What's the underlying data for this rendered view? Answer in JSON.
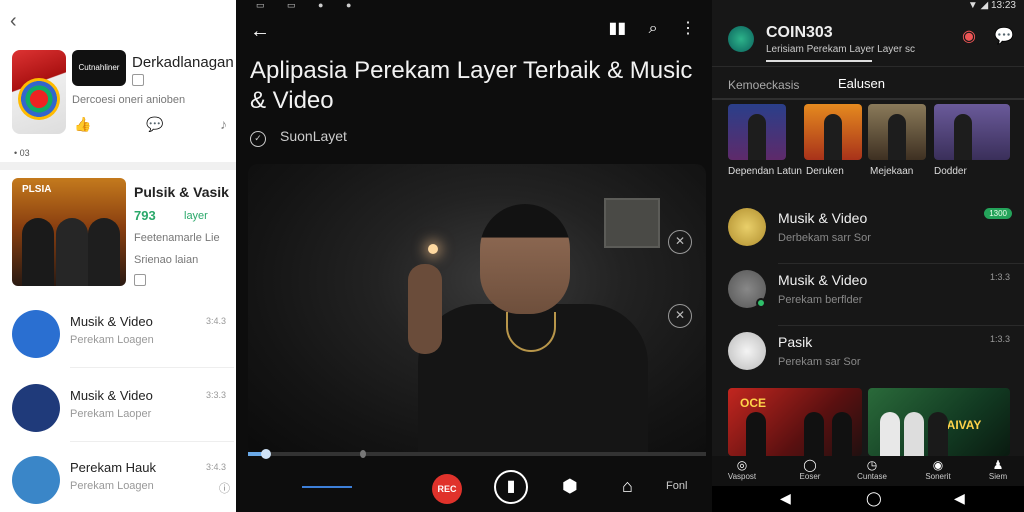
{
  "left": {
    "back_glyph": "‹",
    "app_name": "Derkadlanagan",
    "app_icon_label": "Cutnahliner",
    "app_subtitle": "Dercoesi oneri anioben",
    "meta": "• 03",
    "featured": {
      "title": "Pulsik & Vasik",
      "thumb_text": "PLSIA",
      "badge_value": "793",
      "badge_label": "layer",
      "desc": "Feetenamarle Lie",
      "desc2": "Srienao laian"
    },
    "items": [
      {
        "title": "Musik & Video",
        "subtitle": "Perekam Loagen",
        "count": "3:4.3",
        "color": "#2a6fd1"
      },
      {
        "title": "Musik & Video",
        "subtitle": "Perekam Laoper",
        "count": "3:3.3",
        "color": "#1f3a7a"
      },
      {
        "title": "Perekam Hauk",
        "subtitle": "Perekam Loagen",
        "count": "3:4.3",
        "color": "#3a86c8"
      }
    ]
  },
  "middle": {
    "status": "▭ ▭ ● ●",
    "title": "Aplipasia Perekam Layer Terbaik & Music & Video",
    "author": "SuonLayet",
    "progress": 0.04,
    "mark": 0.25,
    "rec_label": "REC",
    "action_label": "Fonl"
  },
  "right": {
    "status": "▼ ◢ 13:23",
    "title": "COIN303",
    "subtitle": "Lerisiam Perekam Layer Layer sc",
    "tab1": "Kemoeckasis",
    "tab2": "Ealusen",
    "cards": [
      {
        "label": "Dependan Latun",
        "bg": "linear-gradient(180deg,#2a3f8a,#5e2a6a)"
      },
      {
        "label": "Deruken",
        "bg": "linear-gradient(180deg,#e58a1f,#a8321a)"
      },
      {
        "label": "Mejekaan",
        "bg": "linear-gradient(180deg,#8a7a5a,#3e3022)"
      },
      {
        "label": "Dodder",
        "bg": "linear-gradient(180deg,#6a5a9a,#3a2f5a)"
      }
    ],
    "items": [
      {
        "title": "Musik & Video",
        "subtitle": "Derbekam sarr Sor",
        "badge": "1300",
        "color": "#d9b84e"
      },
      {
        "title": "Musik & Video",
        "subtitle": "Perekam berflder",
        "count": "1:3.3",
        "color": "#666"
      },
      {
        "title": "Pasik",
        "subtitle": "Perekam sar Sor",
        "count": "1:3.3",
        "color": "#ddd"
      }
    ],
    "banner1_text": "OCE",
    "banner2_text": "DAIVAY",
    "nav": [
      {
        "glyph": "◎",
        "label": "Vaspost"
      },
      {
        "glyph": "◯",
        "label": "Eoser"
      },
      {
        "glyph": "◷",
        "label": "Cuntase"
      },
      {
        "glyph": "◉",
        "label": "Sonerit"
      },
      {
        "glyph": "♟",
        "label": "Siem"
      }
    ],
    "sys": [
      "◀",
      "◯",
      "◀"
    ]
  }
}
